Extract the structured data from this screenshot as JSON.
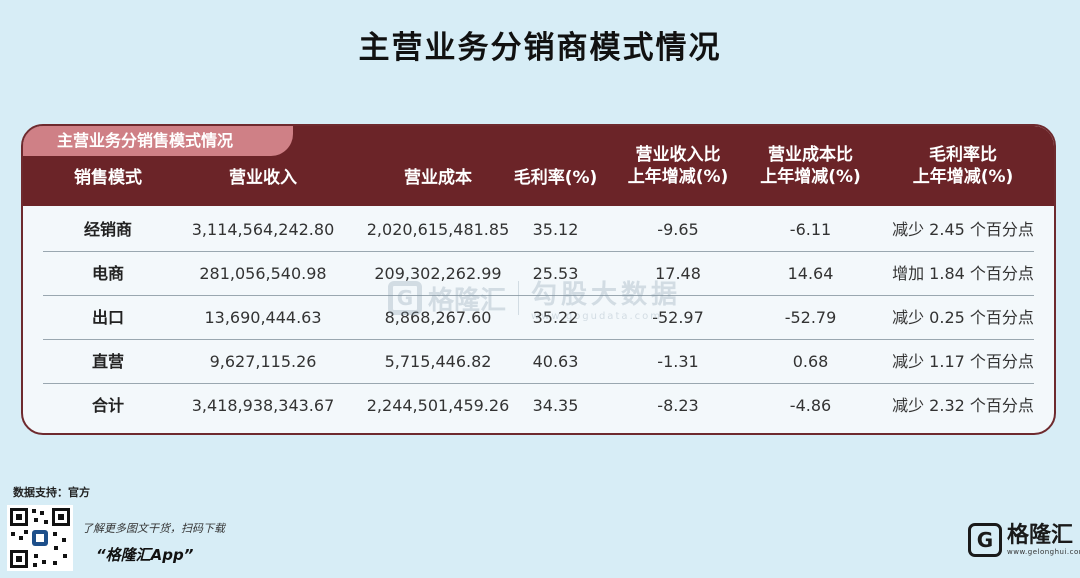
{
  "title": "主营业务分销商模式情况",
  "table": {
    "subtitle": "主营业务分销售模式情况",
    "columns": [
      "销售模式",
      "营业收入",
      "营业成本",
      "毛利率(%)",
      "营业收入比\n上年增减(%)",
      "营业成本比\n上年增减(%)",
      "毛利率比\n上年增减(%)"
    ],
    "rows": [
      [
        "经销商",
        "3,114,564,242.80",
        "2,020,615,481.85",
        "35.12",
        "-9.65",
        "-6.11",
        "减少 2.45 个百分点"
      ],
      [
        "电商",
        "281,056,540.98",
        "209,302,262.99",
        "25.53",
        "17.48",
        "14.64",
        "增加 1.84 个百分点"
      ],
      [
        "出口",
        "13,690,444.63",
        "8,868,267.60",
        "35.22",
        "-52.97",
        "-52.79",
        "减少 0.25 个百分点"
      ],
      [
        "直营",
        "9,627,115.26",
        "5,715,446.82",
        "40.63",
        "-1.31",
        "0.68",
        "减少 1.17 个百分点"
      ],
      [
        "合计",
        "3,418,938,343.67",
        "2,244,501,459.26",
        "34.35",
        "-8.23",
        "-4.86",
        "减少 2.32 个百分点"
      ]
    ]
  },
  "watermark": {
    "brand": "格隆汇",
    "text": "勾股大数据",
    "url": "www.gogudata.com"
  },
  "footer": {
    "source": "数据支持：官方",
    "tagline": "了解更多图文干货，扫码下载",
    "app_name": "“格隆汇App”",
    "brand_name": "格隆汇",
    "brand_url": "www.gelonghui.com"
  },
  "colors": {
    "header_bg": "#6b2428",
    "subtitle_bg": "#cf8086",
    "page_bg": "#d7edf6"
  }
}
